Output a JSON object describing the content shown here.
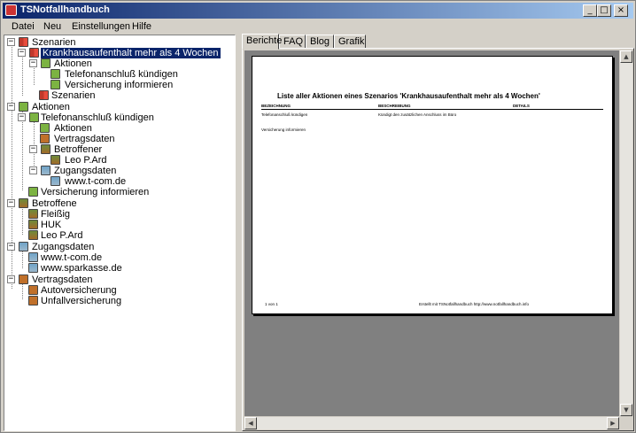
{
  "window": {
    "title": "TSNotfallhandbuch"
  },
  "controls": {
    "minimize": "_",
    "maximize": "□",
    "close": "×"
  },
  "menu": [
    {
      "label": "Datei"
    },
    {
      "label": "Neu"
    },
    {
      "label": "Einstellungen"
    },
    {
      "label": "Hilfe"
    }
  ],
  "tree": [
    {
      "label": "Szenarien",
      "icon": "book-icon"
    },
    {
      "label": "Krankhausaufenthalt mehr als 4 Wochen",
      "icon": "book-icon",
      "selected": true
    },
    {
      "label": "Aktionen",
      "icon": "action-icon"
    },
    {
      "label": "Telefonanschluß kündigen",
      "icon": "action-icon"
    },
    {
      "label": "Versicherung informieren",
      "icon": "action-icon"
    },
    {
      "label": "Szenarien",
      "icon": "book-icon"
    },
    {
      "label": "Aktionen",
      "icon": "action-icon"
    },
    {
      "label": "Telefonanschluß kündigen",
      "icon": "action-icon"
    },
    {
      "label": "Aktionen",
      "icon": "action-icon"
    },
    {
      "label": "Vertragsdaten",
      "icon": "contract-icon"
    },
    {
      "label": "Betroffener",
      "icon": "person-icon"
    },
    {
      "label": "Leo P.Ard",
      "icon": "person-icon"
    },
    {
      "label": "Zugangsdaten",
      "icon": "access-icon"
    },
    {
      "label": "www.t-com.de",
      "icon": "access-icon"
    },
    {
      "label": "Versicherung informieren",
      "icon": "action-icon"
    },
    {
      "label": "Betroffene",
      "icon": "person-icon"
    },
    {
      "label": "Fleißig",
      "icon": "person-icon"
    },
    {
      "label": "HUK",
      "icon": "person-icon"
    },
    {
      "label": "Leo P.Ard",
      "icon": "person-icon"
    },
    {
      "label": "Zugangsdaten",
      "icon": "access-icon"
    },
    {
      "label": "www.t-com.de",
      "icon": "access-icon"
    },
    {
      "label": "www.sparkasse.de",
      "icon": "access-icon"
    },
    {
      "label": "Vertragsdaten",
      "icon": "contract-icon"
    },
    {
      "label": "Autoversicherung",
      "icon": "contract-icon"
    },
    {
      "label": "Unfallversicherung",
      "icon": "contract-icon"
    }
  ],
  "tabs": [
    {
      "label": "Berichte",
      "active": true
    },
    {
      "label": "FAQ"
    },
    {
      "label": "Blog"
    },
    {
      "label": "Grafik"
    }
  ],
  "report": {
    "title": "Liste aller Aktionen eines Szenarios  'Krankhausaufenthalt mehr als 4 Wochen'",
    "columns": [
      "BEZEICHNUNG",
      "BESCHREIBUNG",
      "DETAILS"
    ],
    "rows": [
      [
        "Telefonanschluß kündigen",
        "Kündigt den zusätzlichen Anschluss im Büro",
        ""
      ],
      [
        "Versicherung informieren",
        "",
        ""
      ]
    ],
    "page_info": "1 von 1",
    "credit": "Erstellt mit TSNotfallhandbuch http://www.notfallhandbuch.info"
  },
  "scroll": {
    "up": "▲",
    "down": "▼",
    "left": "◀",
    "right": "▶"
  }
}
